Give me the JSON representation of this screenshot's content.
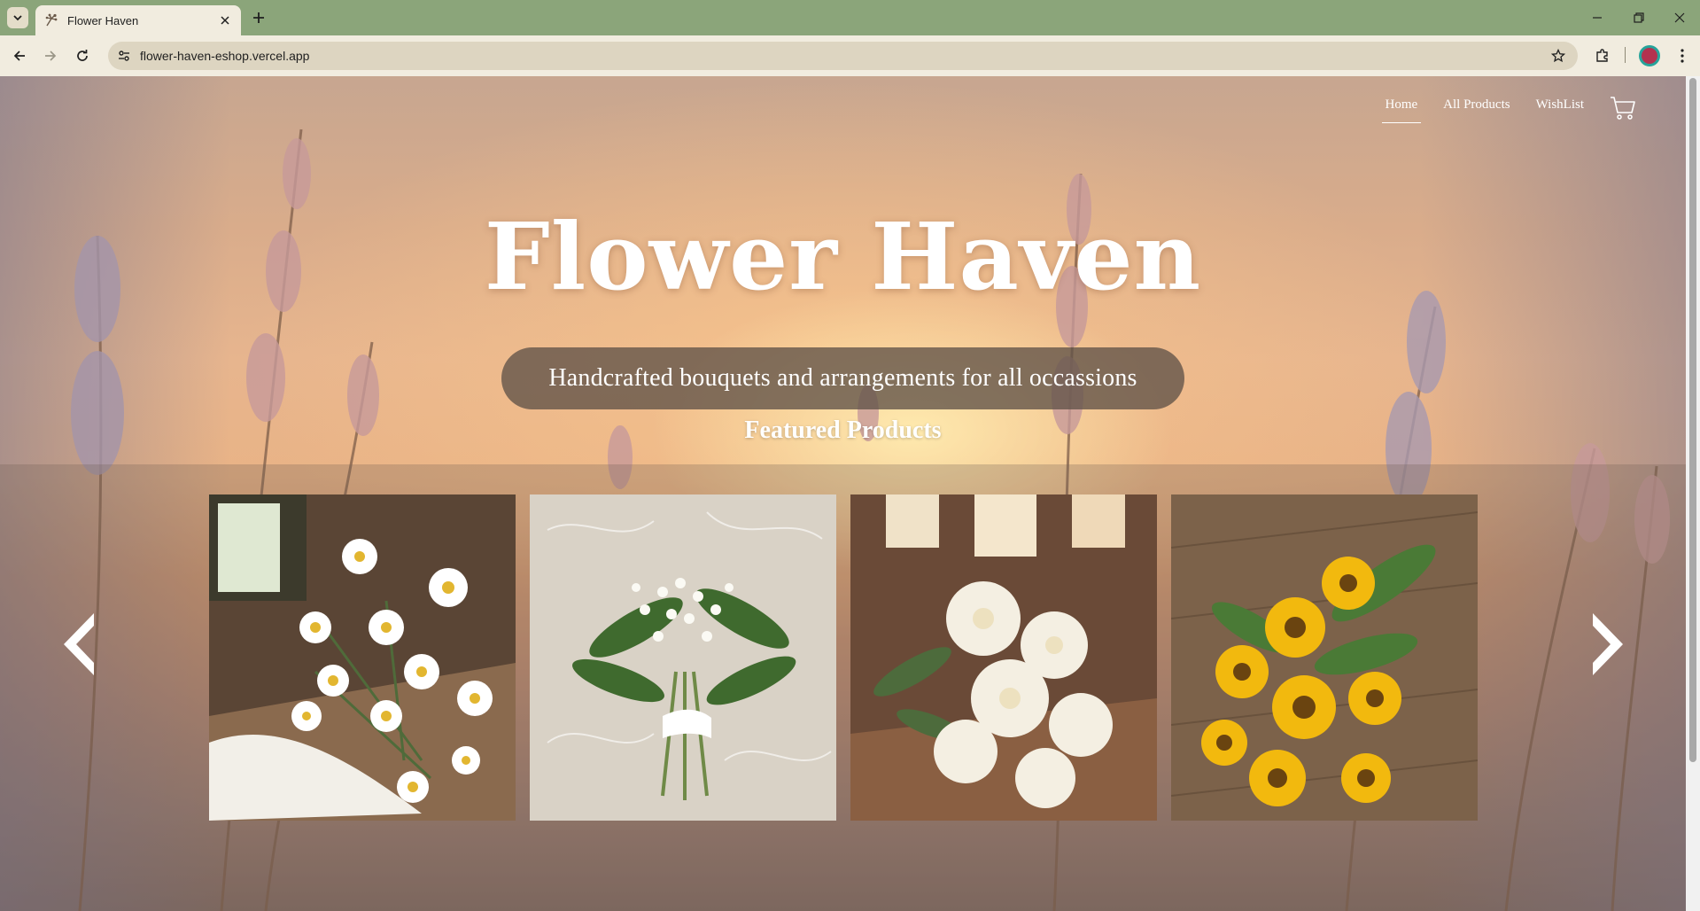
{
  "browser": {
    "tab_title": "Flower Haven",
    "url": "flower-haven-eshop.vercel.app",
    "icons": {
      "tab_search": "chevron-down-icon",
      "favicon": "dandelion-icon",
      "close": "close-icon",
      "new_tab": "plus-icon",
      "back": "back-arrow-icon",
      "forward": "forward-arrow-icon",
      "reload": "reload-icon",
      "site_info": "tune-icon",
      "bookmark": "star-icon",
      "extensions": "puzzle-icon",
      "menu": "kebab-menu-icon"
    },
    "colors": {
      "frame": "#8ba57a",
      "toolbar": "#f1ecdf",
      "omnibox": "#ddd5c1"
    }
  },
  "site": {
    "nav": [
      {
        "label": "Home",
        "active": true
      },
      {
        "label": "All Products",
        "active": false
      },
      {
        "label": "WishList",
        "active": false
      }
    ],
    "cart_icon": "cart-icon",
    "hero": {
      "title": "Flower Haven",
      "tagline": "Handcrafted bouquets and arrangements for all occassions"
    },
    "featured": {
      "heading": "Featured Products",
      "products": [
        {
          "image": "white daisies bouquet on rustic wooden table"
        },
        {
          "image": "lily of the valley bridal bouquet on lace"
        },
        {
          "image": "white chrysanthemums in sunlit room"
        },
        {
          "image": "sunflower bouquet on weathered wood"
        }
      ],
      "prev_icon": "chevron-left-icon",
      "next_icon": "chevron-right-icon"
    }
  }
}
